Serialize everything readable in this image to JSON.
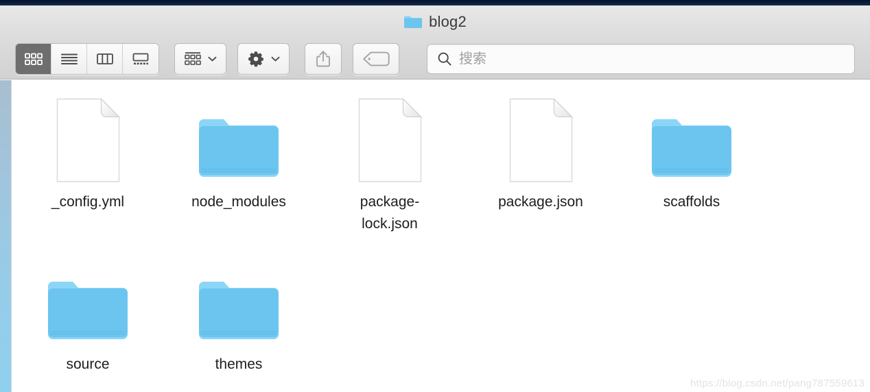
{
  "window": {
    "title": "blog2",
    "title_icon": "folder-icon"
  },
  "toolbar": {
    "view_buttons": [
      {
        "name": "icon-view",
        "label": "Icon View",
        "active": true
      },
      {
        "name": "list-view",
        "label": "List View",
        "active": false
      },
      {
        "name": "column-view",
        "label": "Column View",
        "active": false
      },
      {
        "name": "gallery-view",
        "label": "Gallery View",
        "active": false
      }
    ],
    "arrange_button": {
      "name": "arrange-button",
      "label": "Arrange",
      "icon": "grid-arrange-icon"
    },
    "action_button": {
      "name": "action-button",
      "label": "Action",
      "icon": "gear-icon"
    },
    "share_button": {
      "name": "share-button",
      "label": "Share",
      "icon": "share-icon",
      "disabled": true
    },
    "tag_button": {
      "name": "tag-button",
      "label": "Tags",
      "icon": "tag-icon",
      "disabled": true
    }
  },
  "search": {
    "placeholder": "搜索",
    "value": "",
    "icon": "search-icon"
  },
  "files": {
    "rows": [
      [
        {
          "name": "_config.yml",
          "type": "document"
        },
        {
          "name": "node_modules",
          "type": "folder"
        },
        {
          "name": "package-lock.json",
          "type": "document"
        },
        {
          "name": "package.json",
          "type": "document"
        },
        {
          "name": "scaffolds",
          "type": "folder"
        }
      ],
      [
        {
          "name": "source",
          "type": "folder"
        },
        {
          "name": "themes",
          "type": "folder"
        }
      ]
    ]
  },
  "watermark": {
    "text": "https://blog.csdn.net/pang787559613"
  },
  "colors": {
    "folder_tab": "#8bd5f7",
    "folder_body": "#6cc5ef",
    "toolbar_bg": "#dcdcdc",
    "active_view_bg": "#6e6e6e",
    "label_text": "#1d1d1d",
    "placeholder": "#a0a0a0"
  }
}
